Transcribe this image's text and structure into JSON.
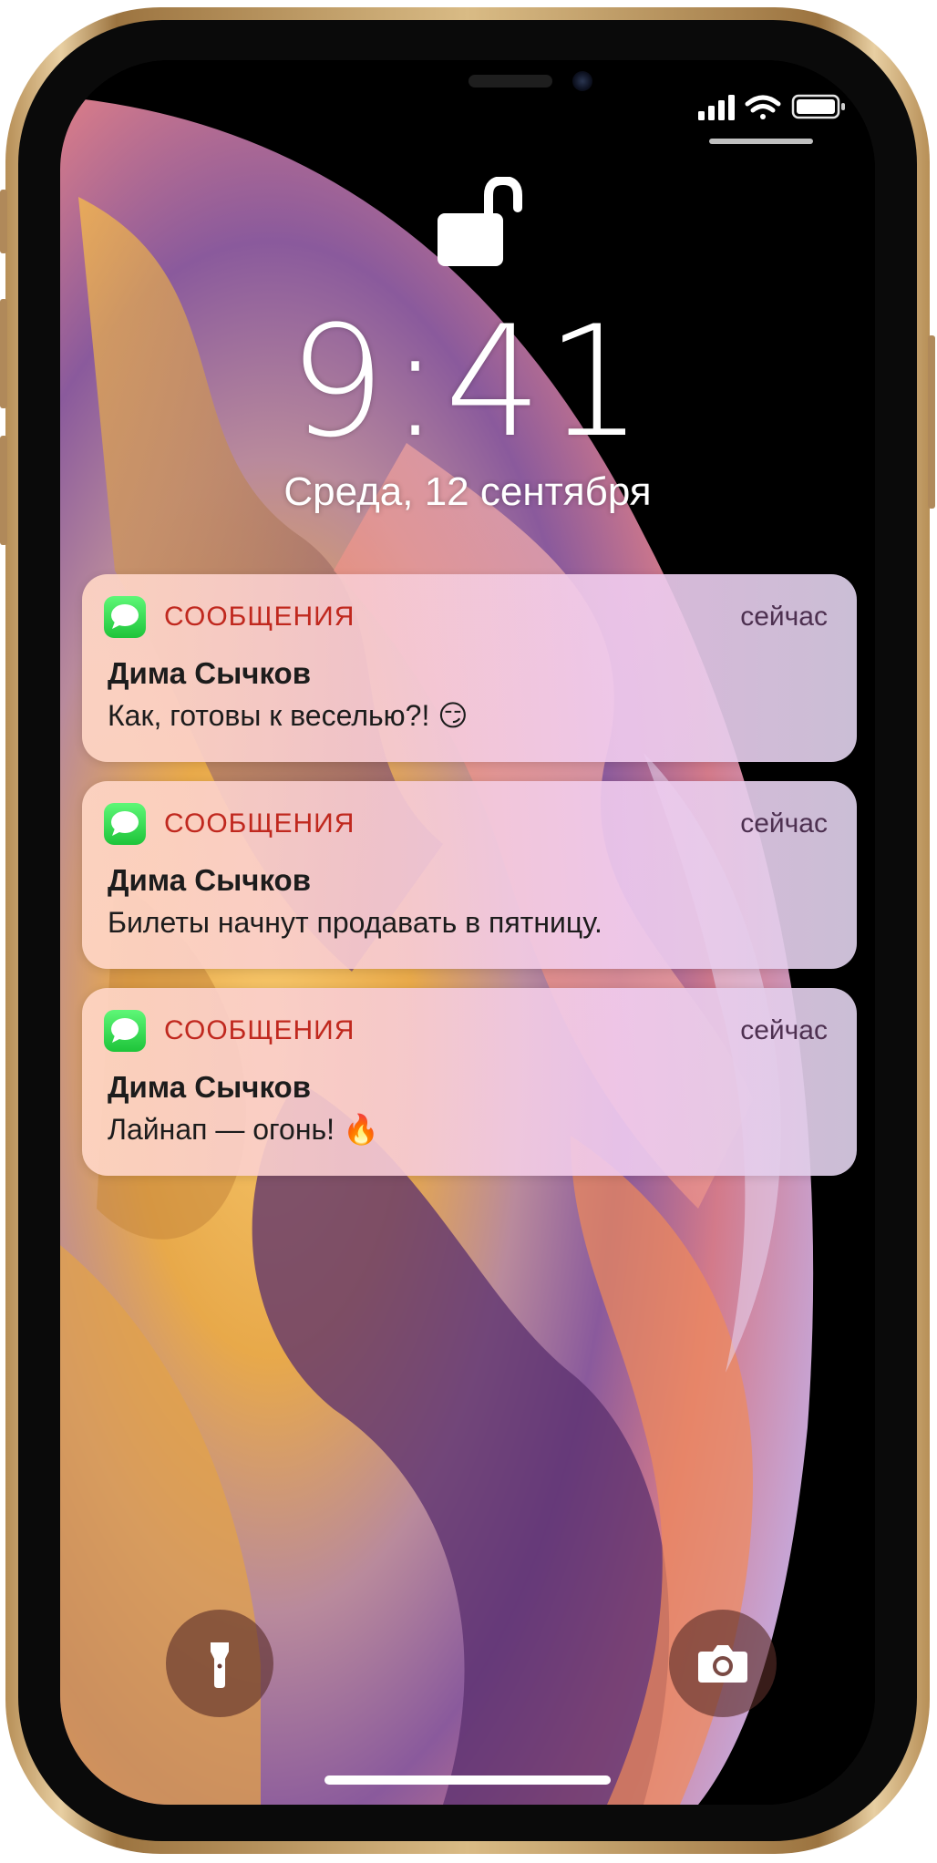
{
  "lockscreen": {
    "time": "9:41",
    "date": "Среда, 12 сентября"
  },
  "status_bar": {
    "icons": [
      "cellular-signal-icon",
      "wifi-icon",
      "battery-icon"
    ]
  },
  "notifications": [
    {
      "app": "СООБЩЕНИЯ",
      "time": "сейчас",
      "sender": "Дима Сычков",
      "message": "Как, готовы к веселью?! 😏",
      "icon": "messages-app-icon"
    },
    {
      "app": "СООБЩЕНИЯ",
      "time": "сейчас",
      "sender": "Дима Сычков",
      "message": "Билеты начнут продавать в пятницу.",
      "icon": "messages-app-icon"
    },
    {
      "app": "СООБЩЕНИЯ",
      "time": "сейчас",
      "sender": "Дима Сычков",
      "message": "Лайнап — огонь! 🔥",
      "icon": "messages-app-icon"
    }
  ],
  "quick_actions": {
    "left": "flashlight-icon",
    "right": "camera-icon"
  },
  "colors": {
    "app_name": "#c0281e",
    "messages_green": "#1ec43a",
    "phone_frame_gold": "#c9a56e"
  }
}
